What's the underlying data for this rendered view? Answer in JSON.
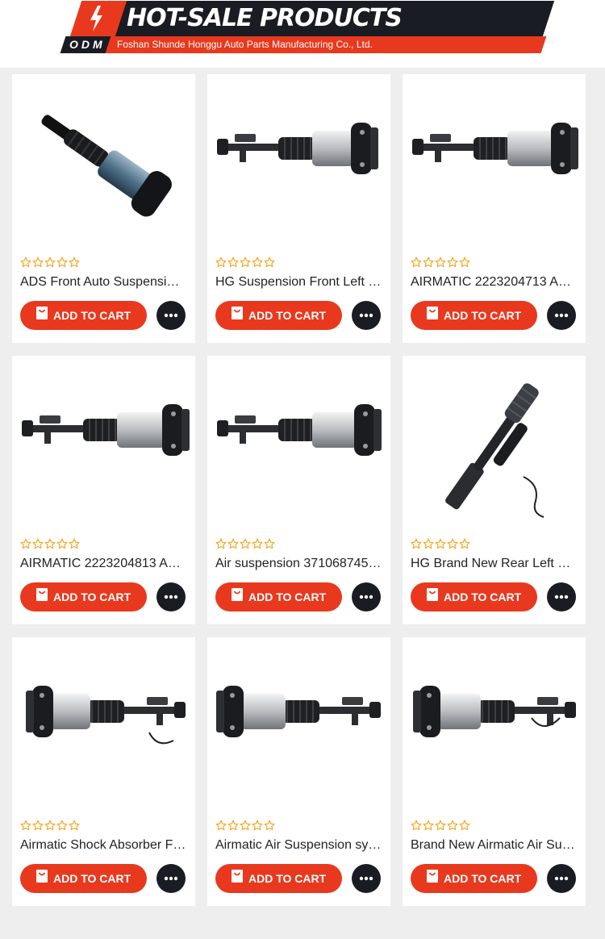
{
  "header": {
    "title": "HOT-SALE PRODUCTS",
    "badge": "ODM",
    "company": "Foshan Shunde Honggu Auto Parts Manufacturing Co., Ltd."
  },
  "colors": {
    "accent": "#e8391f",
    "dark": "#1a1c23",
    "star": "#f5a623"
  },
  "icons": {
    "bolt": "lightning-bolt-icon",
    "cart": "shopping-bag-icon",
    "more": "more-dots-icon",
    "star": "star-outline-icon"
  },
  "rating_stars": 5,
  "products": [
    {
      "title": "ADS Front Auto Suspensi…",
      "button": "ADD TO CART"
    },
    {
      "title": "HG Suspension Front Left …",
      "button": "ADD TO CART"
    },
    {
      "title": "AIRMATIC 2223204713 A…",
      "button": "ADD TO CART"
    },
    {
      "title": "AIRMATIC 2223204813 A…",
      "button": "ADD TO CART"
    },
    {
      "title": "Air suspension 371068745…",
      "button": "ADD TO CART"
    },
    {
      "title": "HG Brand New Rear Left …",
      "button": "ADD TO CART"
    },
    {
      "title": "Airmatic Shock Absorber F…",
      "button": "ADD TO CART"
    },
    {
      "title": "Airmatic Air Suspension sy…",
      "button": "ADD TO CART"
    },
    {
      "title": "Brand New Airmatic Air Su…",
      "button": "ADD TO CART"
    }
  ]
}
